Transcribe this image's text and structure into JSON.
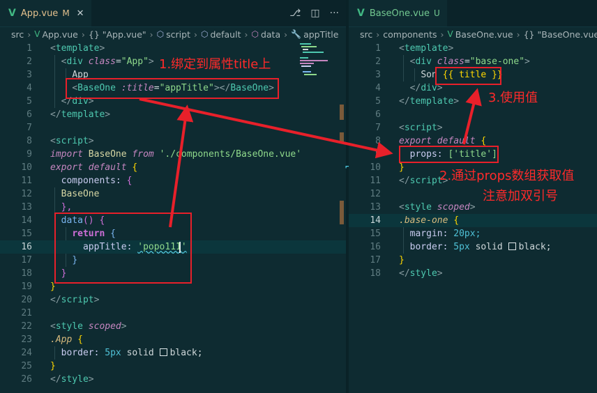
{
  "left": {
    "tab": {
      "icon": "vue-icon",
      "name": "App.vue",
      "status": "M",
      "close": "✕"
    },
    "actions": [
      "source-control-icon",
      "split-editor-icon",
      "more-icon"
    ],
    "breadcrumb": {
      "src": "src",
      "file": "App.vue",
      "obj": "{} \"App.vue\"",
      "script": "script",
      "default": "default",
      "data": "data",
      "prop": "appTitle"
    },
    "lines": {
      "n1": "1",
      "n2": "2",
      "n3": "3",
      "n4": "4",
      "n5": "5",
      "n6": "6",
      "n7": "7",
      "n8": "8",
      "n9": "9",
      "n10": "10",
      "n11": "11",
      "n12": "12",
      "n13": "13",
      "n14": "14",
      "n15": "15",
      "n16": "16",
      "n17": "17",
      "n18": "18",
      "n19": "19",
      "n20": "20",
      "n21": "21",
      "n22": "22",
      "n23": "23",
      "n24": "24",
      "n25": "25",
      "n26": "26"
    },
    "code": {
      "template_open": "template",
      "div": "div",
      "class_attr": "class",
      "class_val": "\"App\"",
      "app_text": "App",
      "baseone_tag": "BaseOne",
      "title_attr": ":title",
      "title_val": "\"appTitle\"",
      "baseone_close": "BaseOne",
      "div_close": "div",
      "template_close": "template",
      "script_open": "script",
      "import_kw": "import",
      "import_id": "BaseOne",
      "from_kw": "from",
      "import_path": "'./components/BaseOne.vue'",
      "export_kw": "export",
      "default_kw": "default",
      "brace_open": "{",
      "components_key": "components:",
      "components_brace": "{",
      "baseone_id": "BaseOne",
      "comp_close": "},",
      "data_fn": "data",
      "data_paren": "() {",
      "return_kw": "return",
      "return_brace": "{",
      "apptitle_key": "appTitle:",
      "apptitle_val": "'popo111'",
      "inner_close": "}",
      "data_close": "}",
      "export_close": "}",
      "script_close": "script",
      "style_open": "style",
      "scoped": "scoped",
      "sel": ".App",
      "sel_brace": "{",
      "border_key": "border:",
      "border_num": "5px",
      "border_solid": "solid",
      "border_color": "black;",
      "style_brace_close": "}",
      "style_close": "style"
    }
  },
  "right": {
    "tab": {
      "icon": "vue-icon",
      "name": "BaseOne.vue",
      "status": "U"
    },
    "breadcrumb": {
      "src": "src",
      "components": "components",
      "file": "BaseOne.vue",
      "obj": "{} \"BaseOne.vue\""
    },
    "lines": {
      "n1": "1",
      "n2": "2",
      "n3": "3",
      "n4": "4",
      "n5": "5",
      "n6": "6",
      "n7": "7",
      "n8": "8",
      "n9": "9",
      "n10": "10",
      "n11": "11",
      "n12": "12",
      "n13": "13",
      "n14": "14",
      "n15": "15",
      "n16": "16",
      "n17": "17",
      "n18": "18"
    },
    "code": {
      "template_open": "template",
      "div": "div",
      "class_attr": "class",
      "class_val": "\"base-one\"",
      "son_text": "Son",
      "mustache": "{{ title }}",
      "div_close": "div",
      "template_close": "template",
      "script_open": "script",
      "export_kw": "export",
      "default_kw": "default",
      "brace": "{",
      "props_key": "props:",
      "props_val": "['title']",
      "close_brace": "}",
      "script_close": "script",
      "style_open": "style",
      "scoped": "scoped",
      "sel": ".base-one",
      "sel_brace": "{",
      "margin_key": "margin:",
      "margin_val": "20px;",
      "border_key": "border:",
      "border_num": "5px",
      "border_solid": "solid",
      "border_color": "black;",
      "style_brace_close": "}",
      "style_close": "style"
    }
  },
  "annotations": {
    "a1": "1.绑定到属性title上",
    "a2_line1": "2.通过props数组获取值",
    "a2_line2": "注意加双引号",
    "a3": "3.使用值"
  },
  "colors": {
    "annotation": "#ff2a2a",
    "background": "#0e2b31",
    "vue": "#41b883"
  }
}
